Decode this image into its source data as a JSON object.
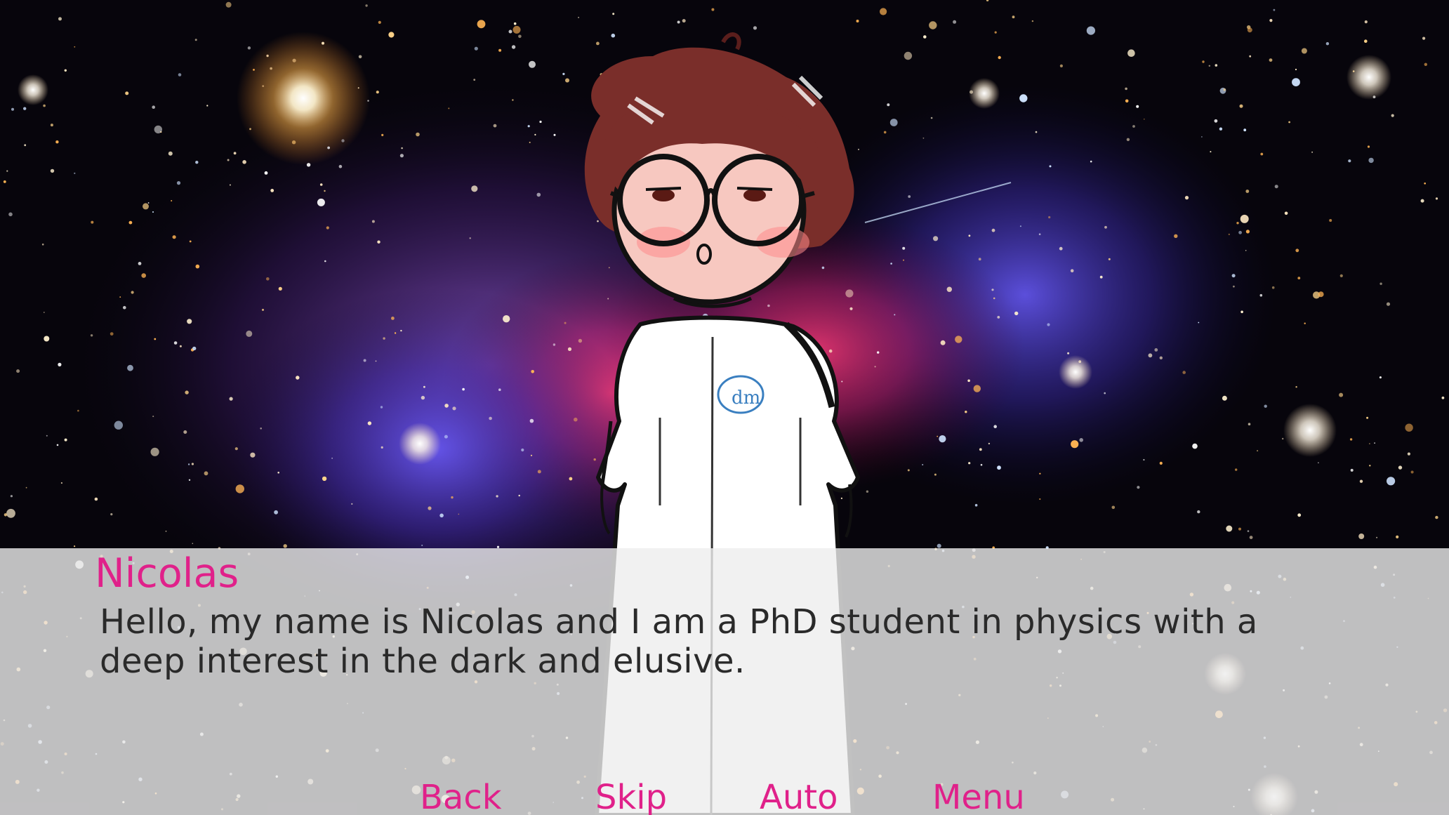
{
  "scene": {
    "background": "deep-space-galaxy-cluster",
    "character": "nicolas-labcoat",
    "colors": {
      "accent": "#e0218a",
      "text": "#2a2a2a",
      "textbox": "#eeeeee"
    }
  },
  "dialogue": {
    "speaker": "Nicolas",
    "lines": [
      "Hello, my name is Nicolas and I am a PhD student in physics with a",
      "deep interest in the dark and elusive."
    ]
  },
  "quick_menu": {
    "back": "Back",
    "skip": "Skip",
    "auto": "Auto",
    "menu": "Menu"
  }
}
